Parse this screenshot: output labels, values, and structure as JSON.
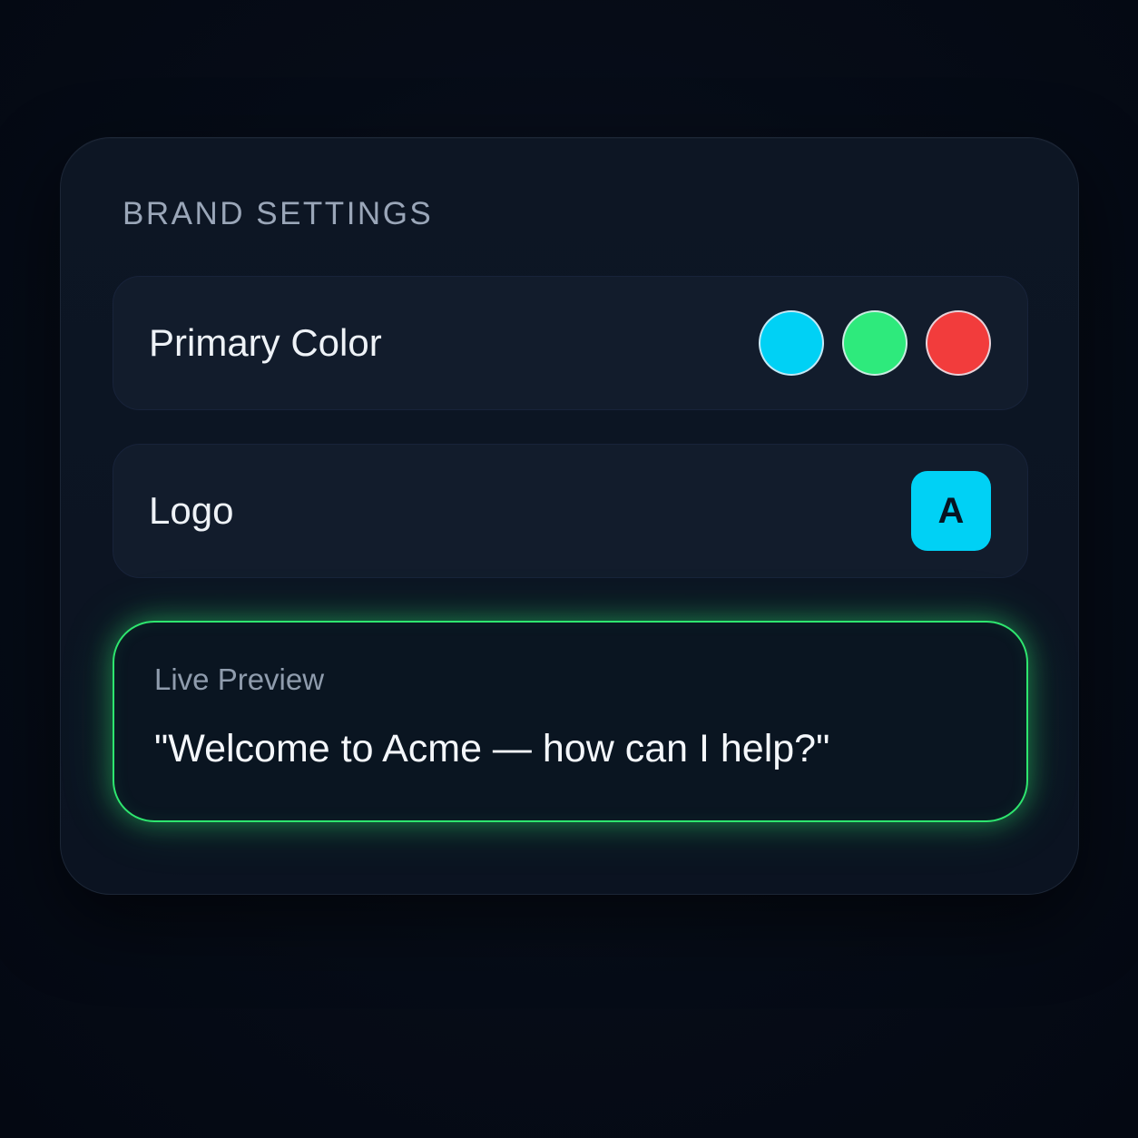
{
  "panel": {
    "title": "BRAND SETTINGS"
  },
  "primary_color": {
    "label": "Primary Color",
    "swatches": [
      {
        "name": "cyan",
        "color": "#00d1f5"
      },
      {
        "name": "green",
        "color": "#2eea7c"
      },
      {
        "name": "red",
        "color": "#f23c3c"
      }
    ]
  },
  "logo": {
    "label": "Logo",
    "letter": "A",
    "tile_color": "#00d1f5"
  },
  "preview": {
    "label": "Live Preview",
    "text": "\"Welcome to Acme — how can I help?\"",
    "accent": "#2ee66f"
  }
}
